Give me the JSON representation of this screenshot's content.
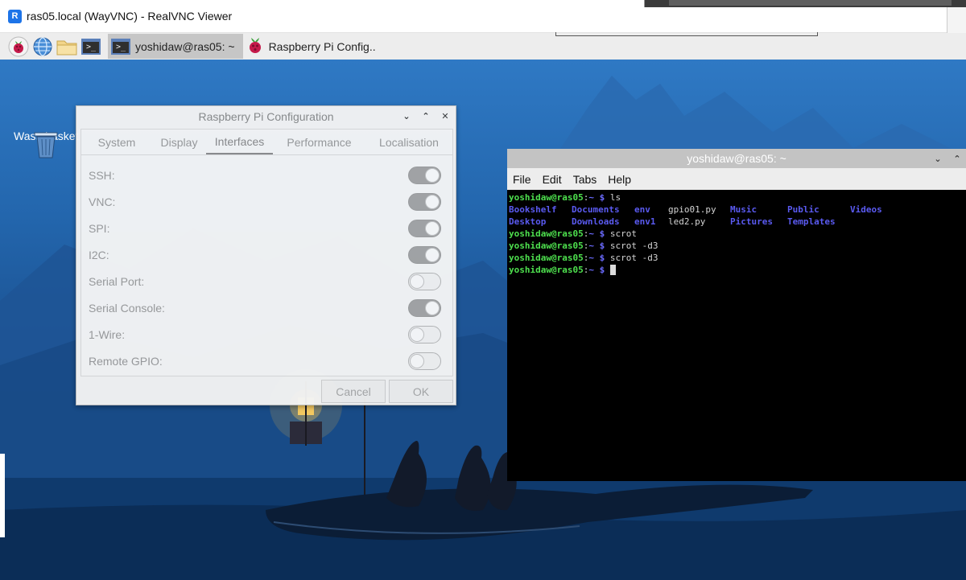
{
  "host_window": {
    "logo_text": "R",
    "title": "ras05.local (WayVNC) - RealVNC Viewer"
  },
  "taskbar": {
    "launchers": [
      {
        "icon": "raspberry-menu-icon"
      },
      {
        "icon": "web-browser-icon"
      },
      {
        "icon": "file-manager-icon"
      },
      {
        "icon": "terminal-icon"
      }
    ],
    "term_glyph": ">_",
    "tasks": [
      {
        "label": "yoshidaw@ras05: ~",
        "icon": "terminal-icon",
        "active": true
      },
      {
        "label": "Raspberry Pi Config..",
        "icon": "raspberry-icon",
        "active": false
      }
    ]
  },
  "desktop": {
    "wastebasket_label": "Wastebasket"
  },
  "config_dialog": {
    "title": "Raspberry Pi Configuration",
    "window_controls": {
      "minimize": "⌄",
      "maximize": "⌃",
      "close": "✕"
    },
    "tabs": [
      "System",
      "Display",
      "Interfaces",
      "Performance",
      "Localisation"
    ],
    "active_tab": "Interfaces",
    "settings": [
      {
        "label": "SSH:",
        "enabled": true
      },
      {
        "label": "VNC:",
        "enabled": true
      },
      {
        "label": "SPI:",
        "enabled": true
      },
      {
        "label": "I2C:",
        "enabled": true
      },
      {
        "label": "Serial Port:",
        "enabled": false
      },
      {
        "label": "Serial Console:",
        "enabled": true
      },
      {
        "label": "1-Wire:",
        "enabled": false
      },
      {
        "label": "Remote GPIO:",
        "enabled": false
      }
    ],
    "cancel_label": "Cancel",
    "ok_label": "OK"
  },
  "terminal": {
    "title": "yoshidaw@ras05: ~",
    "window_controls": {
      "minimize": "⌄",
      "maximize": "⌃"
    },
    "menu": [
      "File",
      "Edit",
      "Tabs",
      "Help"
    ],
    "prompt_user": "yoshidaw@ras05",
    "prompt_sep": ":",
    "prompt_path": "~",
    "prompt_sym": " $ ",
    "lines": [
      {
        "type": "prompt",
        "cmd": "ls"
      },
      {
        "type": "ls",
        "cells": [
          {
            "text": "Bookshelf",
            "kind": "dir"
          },
          {
            "text": "Documents",
            "kind": "dir"
          },
          {
            "text": "env",
            "kind": "dir"
          },
          {
            "text": "gpio01.py",
            "kind": "file"
          },
          {
            "text": "Music",
            "kind": "dir"
          },
          {
            "text": "Public",
            "kind": "dir"
          },
          {
            "text": "Videos",
            "kind": "dir"
          }
        ]
      },
      {
        "type": "ls",
        "cells": [
          {
            "text": "Desktop",
            "kind": "dir"
          },
          {
            "text": "Downloads",
            "kind": "dir"
          },
          {
            "text": "env1",
            "kind": "dir"
          },
          {
            "text": "led2.py",
            "kind": "file"
          },
          {
            "text": "Pictures",
            "kind": "dir"
          },
          {
            "text": "Templates",
            "kind": "dir"
          }
        ]
      },
      {
        "type": "prompt",
        "cmd": "scrot"
      },
      {
        "type": "prompt",
        "cmd": "scrot -d3"
      },
      {
        "type": "prompt",
        "cmd": "scrot -d3"
      },
      {
        "type": "prompt",
        "cmd": "",
        "cursor": true
      }
    ]
  }
}
